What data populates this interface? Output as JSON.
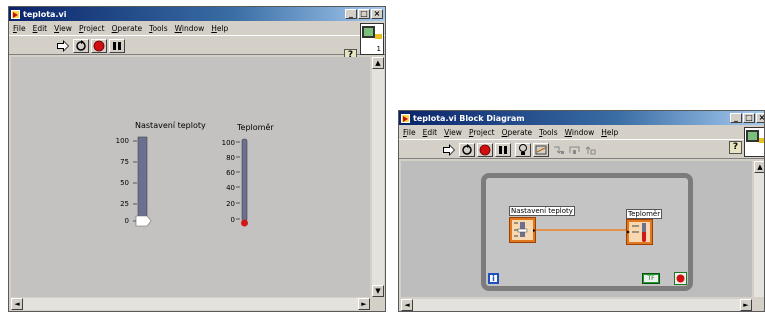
{
  "front_panel": {
    "title": "teplota.vi",
    "menu": [
      "File",
      "Edit",
      "View",
      "Project",
      "Operate",
      "Tools",
      "Window",
      "Help"
    ],
    "help_glyph": "?",
    "connector_number": "1",
    "knob_label": "Nastavení teploty",
    "knob_ticks": [
      "100",
      "75",
      "50",
      "25",
      "0"
    ],
    "knob_value": 0,
    "thermo_label": "Teploměr",
    "thermo_ticks": [
      "100",
      "80",
      "60",
      "40",
      "20",
      "0"
    ],
    "thermo_value": 0
  },
  "block_diagram": {
    "title": "teplota.vi Block Diagram",
    "menu": [
      "File",
      "Edit",
      "View",
      "Project",
      "Operate",
      "Tools",
      "Window",
      "Help"
    ],
    "help_glyph": "?",
    "node1_label": "Nastavení teploty",
    "node2_label": "Teploměr",
    "iteration_terminal": "i",
    "constant_value": "TF"
  },
  "window_controls": {
    "minimize": "_",
    "maximize": "□",
    "close": "×"
  },
  "scroll_glyphs": {
    "up": "▲",
    "down": "▼",
    "left": "◄",
    "right": "►"
  },
  "colors": {
    "titlebar": "#0a246a",
    "panel": "#c4c2c0",
    "wire": "#f08020",
    "thermo_fluid": "#d01818"
  }
}
